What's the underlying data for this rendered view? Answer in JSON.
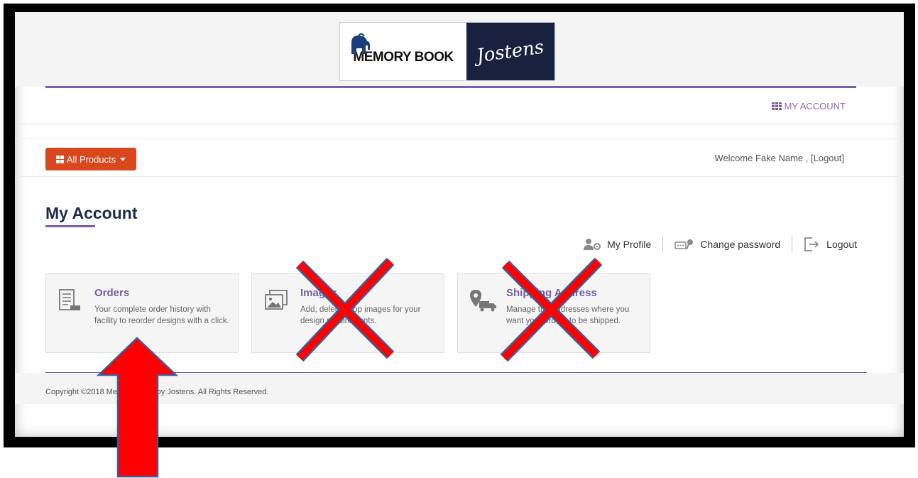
{
  "brand": {
    "logo_left": "MEMORY BOOK",
    "logo_right": "Jostens"
  },
  "topnav": {
    "my_account_label": "MY ACCOUNT"
  },
  "toolbar": {
    "all_products_label": "All Products",
    "welcome_text": "Welcome Fake Name , [Logout]"
  },
  "page": {
    "title": "My Account"
  },
  "quick_links": [
    {
      "label": "My Profile",
      "icon": "profile-icon"
    },
    {
      "label": "Change password",
      "icon": "key-icon"
    },
    {
      "label": "Logout",
      "icon": "logout-icon"
    }
  ],
  "cards": [
    {
      "title": "Orders",
      "desc": "Your complete order history with facility to reorder designs with a click.",
      "icon": "orders-icon"
    },
    {
      "title": "Images",
      "desc": "Add, delete, crop images for your design requirements.",
      "icon": "images-icon"
    },
    {
      "title": "Shipping Address",
      "desc": "Manage the addresses where you want your orders to be shipped.",
      "icon": "shipping-icon"
    }
  ],
  "footer": {
    "copyright": "Copyright ©2018 Memory Book by Jostens. All Rights Reserved."
  },
  "colors": {
    "accent_purple": "#7b5ea7",
    "button_orange": "#d9481d",
    "annotation_red": "#ff0000",
    "annotation_blue": "#3f5c9a"
  }
}
